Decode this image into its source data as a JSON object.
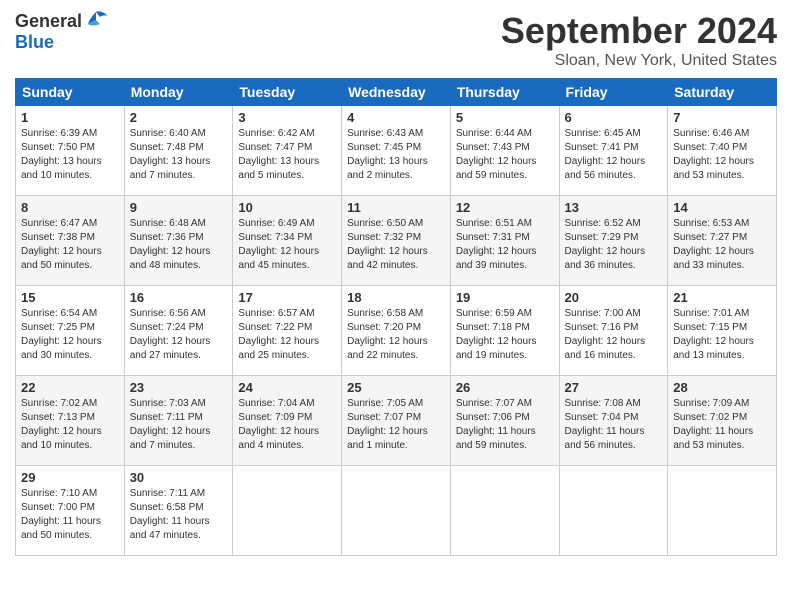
{
  "header": {
    "logo_general": "General",
    "logo_blue": "Blue",
    "month_title": "September 2024",
    "subtitle": "Sloan, New York, United States"
  },
  "days_of_week": [
    "Sunday",
    "Monday",
    "Tuesday",
    "Wednesday",
    "Thursday",
    "Friday",
    "Saturday"
  ],
  "weeks": [
    [
      {
        "day": "1",
        "sunrise": "6:39 AM",
        "sunset": "7:50 PM",
        "daylight": "13 hours and 10 minutes."
      },
      {
        "day": "2",
        "sunrise": "6:40 AM",
        "sunset": "7:48 PM",
        "daylight": "13 hours and 7 minutes."
      },
      {
        "day": "3",
        "sunrise": "6:42 AM",
        "sunset": "7:47 PM",
        "daylight": "13 hours and 5 minutes."
      },
      {
        "day": "4",
        "sunrise": "6:43 AM",
        "sunset": "7:45 PM",
        "daylight": "13 hours and 2 minutes."
      },
      {
        "day": "5",
        "sunrise": "6:44 AM",
        "sunset": "7:43 PM",
        "daylight": "12 hours and 59 minutes."
      },
      {
        "day": "6",
        "sunrise": "6:45 AM",
        "sunset": "7:41 PM",
        "daylight": "12 hours and 56 minutes."
      },
      {
        "day": "7",
        "sunrise": "6:46 AM",
        "sunset": "7:40 PM",
        "daylight": "12 hours and 53 minutes."
      }
    ],
    [
      {
        "day": "8",
        "sunrise": "6:47 AM",
        "sunset": "7:38 PM",
        "daylight": "12 hours and 50 minutes."
      },
      {
        "day": "9",
        "sunrise": "6:48 AM",
        "sunset": "7:36 PM",
        "daylight": "12 hours and 48 minutes."
      },
      {
        "day": "10",
        "sunrise": "6:49 AM",
        "sunset": "7:34 PM",
        "daylight": "12 hours and 45 minutes."
      },
      {
        "day": "11",
        "sunrise": "6:50 AM",
        "sunset": "7:32 PM",
        "daylight": "12 hours and 42 minutes."
      },
      {
        "day": "12",
        "sunrise": "6:51 AM",
        "sunset": "7:31 PM",
        "daylight": "12 hours and 39 minutes."
      },
      {
        "day": "13",
        "sunrise": "6:52 AM",
        "sunset": "7:29 PM",
        "daylight": "12 hours and 36 minutes."
      },
      {
        "day": "14",
        "sunrise": "6:53 AM",
        "sunset": "7:27 PM",
        "daylight": "12 hours and 33 minutes."
      }
    ],
    [
      {
        "day": "15",
        "sunrise": "6:54 AM",
        "sunset": "7:25 PM",
        "daylight": "12 hours and 30 minutes."
      },
      {
        "day": "16",
        "sunrise": "6:56 AM",
        "sunset": "7:24 PM",
        "daylight": "12 hours and 27 minutes."
      },
      {
        "day": "17",
        "sunrise": "6:57 AM",
        "sunset": "7:22 PM",
        "daylight": "12 hours and 25 minutes."
      },
      {
        "day": "18",
        "sunrise": "6:58 AM",
        "sunset": "7:20 PM",
        "daylight": "12 hours and 22 minutes."
      },
      {
        "day": "19",
        "sunrise": "6:59 AM",
        "sunset": "7:18 PM",
        "daylight": "12 hours and 19 minutes."
      },
      {
        "day": "20",
        "sunrise": "7:00 AM",
        "sunset": "7:16 PM",
        "daylight": "12 hours and 16 minutes."
      },
      {
        "day": "21",
        "sunrise": "7:01 AM",
        "sunset": "7:15 PM",
        "daylight": "12 hours and 13 minutes."
      }
    ],
    [
      {
        "day": "22",
        "sunrise": "7:02 AM",
        "sunset": "7:13 PM",
        "daylight": "12 hours and 10 minutes."
      },
      {
        "day": "23",
        "sunrise": "7:03 AM",
        "sunset": "7:11 PM",
        "daylight": "12 hours and 7 minutes."
      },
      {
        "day": "24",
        "sunrise": "7:04 AM",
        "sunset": "7:09 PM",
        "daylight": "12 hours and 4 minutes."
      },
      {
        "day": "25",
        "sunrise": "7:05 AM",
        "sunset": "7:07 PM",
        "daylight": "12 hours and 1 minute."
      },
      {
        "day": "26",
        "sunrise": "7:07 AM",
        "sunset": "7:06 PM",
        "daylight": "11 hours and 59 minutes."
      },
      {
        "day": "27",
        "sunrise": "7:08 AM",
        "sunset": "7:04 PM",
        "daylight": "11 hours and 56 minutes."
      },
      {
        "day": "28",
        "sunrise": "7:09 AM",
        "sunset": "7:02 PM",
        "daylight": "11 hours and 53 minutes."
      }
    ],
    [
      {
        "day": "29",
        "sunrise": "7:10 AM",
        "sunset": "7:00 PM",
        "daylight": "11 hours and 50 minutes."
      },
      {
        "day": "30",
        "sunrise": "7:11 AM",
        "sunset": "6:58 PM",
        "daylight": "11 hours and 47 minutes."
      },
      null,
      null,
      null,
      null,
      null
    ]
  ],
  "labels": {
    "sunrise": "Sunrise:",
    "sunset": "Sunset:",
    "daylight": "Daylight:"
  }
}
